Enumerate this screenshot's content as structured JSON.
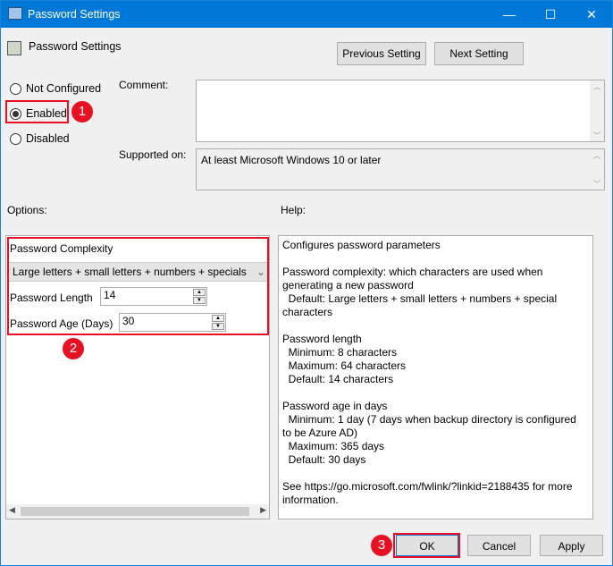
{
  "window": {
    "title": "Password Settings",
    "minimize": "—",
    "maximize": "☐",
    "close": "✕"
  },
  "header": {
    "policy_name": "Password Settings",
    "prev_button": "Previous Setting",
    "next_button": "Next Setting"
  },
  "state": {
    "options": [
      "Not Configured",
      "Enabled",
      "Disabled"
    ],
    "selected": "Enabled"
  },
  "comment": {
    "label": "Comment:",
    "value": ""
  },
  "supported": {
    "label": "Supported on:",
    "value": "At least Microsoft Windows 10 or later"
  },
  "options_panel": {
    "label": "Options:",
    "complexity_label": "Password Complexity",
    "complexity_value": "Large letters + small letters + numbers + specials",
    "length_label": "Password Length",
    "length_value": "14",
    "age_label": "Password Age (Days)",
    "age_value": "30"
  },
  "help_panel": {
    "label": "Help:",
    "text": "Configures password parameters\n\nPassword complexity: which characters are used when generating a new password\n  Default: Large letters + small letters + numbers + special characters\n\nPassword length\n  Minimum: 8 characters\n  Maximum: 64 characters\n  Default: 14 characters\n\nPassword age in days\n  Minimum: 1 day (7 days when backup directory is configured to be Azure AD)\n  Maximum: 365 days\n  Default: 30 days\n\nSee https://go.microsoft.com/fwlink/?linkid=2188435 for more information."
  },
  "footer": {
    "ok": "OK",
    "cancel": "Cancel",
    "apply": "Apply"
  },
  "annotations": {
    "step1": "1",
    "step2": "2",
    "step3": "3"
  }
}
